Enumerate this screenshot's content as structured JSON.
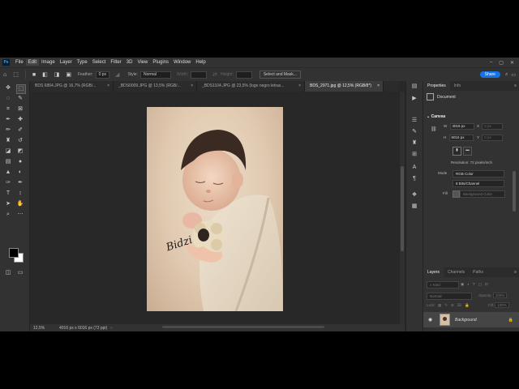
{
  "menubar": {
    "logo": "Ps",
    "items": [
      "File",
      "Edit",
      "Image",
      "Layer",
      "Type",
      "Select",
      "Filter",
      "3D",
      "View",
      "Plugins",
      "Window",
      "Help"
    ],
    "window_controls": [
      "–",
      "▢",
      "✕"
    ]
  },
  "options": {
    "feather_label": "Feather:",
    "feather_value": "0 px",
    "style_label": "Style:",
    "style_value": "Normal",
    "width_label": "Width:",
    "height_label": "Height:",
    "select_mask_label": "Select and Mask...",
    "share_label": "Share"
  },
  "tabs": [
    {
      "label": "BDS 6864.JPG @ 16,7% (RGB/...",
      "close": "×"
    },
    {
      "label": "_BDS0009.JPG @ 13,5% (RGB/...",
      "close": "×"
    },
    {
      "label": "_BDS1104.JPG @ 23,5% (logo negro letras...",
      "close": "×"
    },
    {
      "label": "BDS_2971.jpg @ 12,5% (RGB/8*)",
      "close": "×"
    }
  ],
  "status": {
    "zoom": "12,5%",
    "info": "4016 px x 6016 px (72 ppi)",
    "arrow": "›"
  },
  "properties": {
    "tab_properties": "Properties",
    "tab_info": "Info",
    "doc_label": "Document",
    "canvas_heading": "Canvas",
    "w_label": "W",
    "w_value": "4016 px",
    "h_label": "H",
    "h_value": "6016 px",
    "x_label": "X",
    "x_value": "0 px",
    "y_label": "Y",
    "y_value": "0 px",
    "resolution": "Resolution: 72 pixels/inch",
    "mode_label": "Mode",
    "mode_value": "RGB Color",
    "depth_value": "8 Bits/Channel",
    "fill_label": "Fill",
    "fill_value": "Background Color"
  },
  "layers": {
    "tab_layers": "Layers",
    "tab_channels": "Channels",
    "tab_paths": "Paths",
    "kind_label": "Kind",
    "blend_mode": "Normal",
    "opacity_label": "Opacity:",
    "opacity_value": "100%",
    "lock_label": "Lock:",
    "fill_label": "Fill:",
    "fill_value": "100%",
    "layer_name": "Background"
  },
  "image": {
    "signature": "Bidzi"
  }
}
